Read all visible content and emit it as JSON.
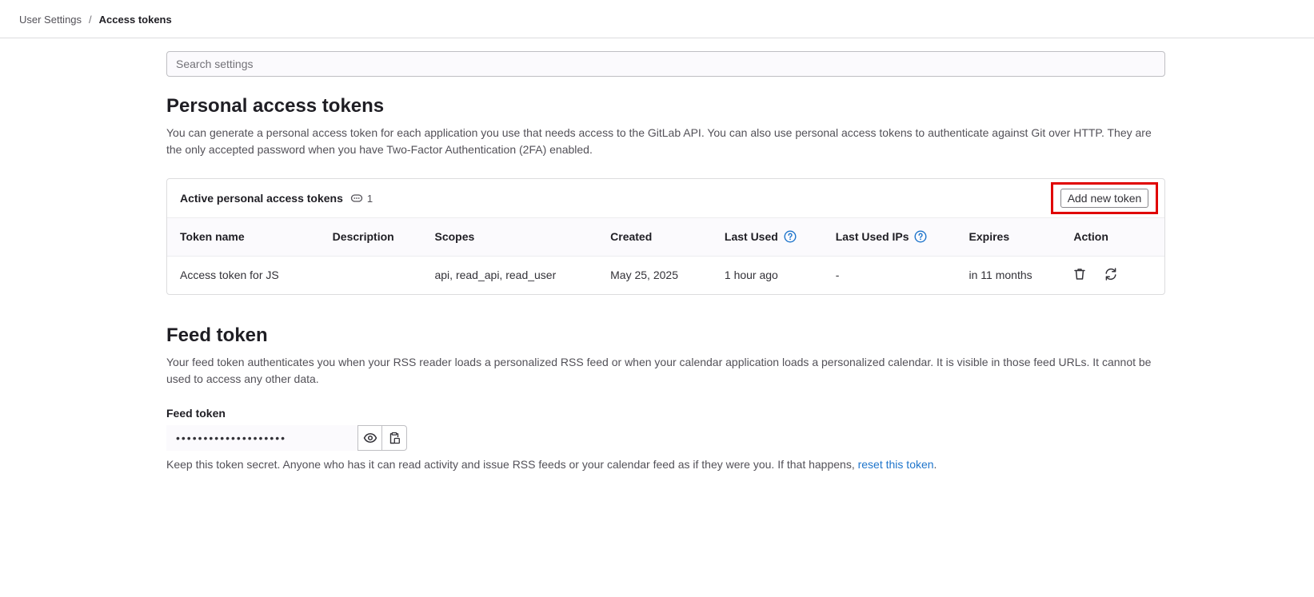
{
  "breadcrumb": {
    "parent": "User Settings",
    "separator": "/",
    "current": "Access tokens"
  },
  "search": {
    "placeholder": "Search settings",
    "value": ""
  },
  "pat": {
    "title": "Personal access tokens",
    "description": "You can generate a personal access token for each application you use that needs access to the GitLab API. You can also use personal access tokens to authenticate against Git over HTTP. They are the only accepted password when you have Two-Factor Authentication (2FA) enabled.",
    "card_title": "Active personal access tokens",
    "count": "1",
    "add_button": "Add new token",
    "columns": [
      "Token name",
      "Description",
      "Scopes",
      "Created",
      "Last Used",
      "Last Used IPs",
      "Expires",
      "Action"
    ],
    "rows": [
      {
        "name": "Access token for JS",
        "description": "",
        "scopes": "api, read_api, read_user",
        "created": "May 25, 2025",
        "last_used": "1 hour ago",
        "last_used_ips": "-",
        "expires": "in 11 months"
      }
    ]
  },
  "feed": {
    "title": "Feed token",
    "description": "Your feed token authenticates you when your RSS reader loads a personalized RSS feed or when your calendar application loads a personalized calendar. It is visible in those feed URLs. It cannot be used to access any other data.",
    "label": "Feed token",
    "masked_value": "••••••••••••••••••••",
    "help_prefix": "Keep this token secret. Anyone who has it can read activity and issue RSS feeds or your calendar feed as if they were you. If that happens, ",
    "help_link": "reset this token",
    "help_suffix": "."
  },
  "icons": {
    "count": "token-count-icon",
    "help": "question-circle-icon",
    "revoke": "trash-icon",
    "rotate": "rotate-icon",
    "reveal": "eye-icon",
    "copy": "clipboard-icon"
  },
  "colors": {
    "link": "#1f75cb",
    "highlight": "#e00000"
  }
}
